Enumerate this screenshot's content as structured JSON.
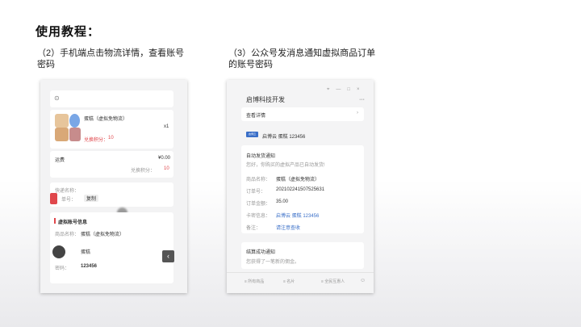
{
  "heading": "使用教程：",
  "left_caption": "（2）手机端点击物流详情，查看账号密码",
  "right_caption": "（3）公众号发消息通知虚拟商品订单的账号密码",
  "phone": {
    "product_name": "蛋糕（虚拟免物流）",
    "qty": "x1",
    "points_label": "兑换积分：",
    "points_value": "10",
    "freight_label": "运费",
    "freight_value": "¥0.00",
    "points2_label": "兑换积分：",
    "points2_value": "10",
    "express_name_label": "快递名称：",
    "tracking_label": "单号：",
    "copy_label": "复制",
    "virtual_title": "虚拟账号信息",
    "goods_name_label": "商品名称：",
    "goods_name_value": "蛋糕（虚拟免物流）",
    "account_value": "蛋糕",
    "password_label": "密码：",
    "password_value": "123456"
  },
  "wechat": {
    "window_controls": [
      "⌖",
      "—",
      "□",
      "×"
    ],
    "account_title": "启博科技开发",
    "more": "···",
    "view_detail": "查看详情",
    "brand_tag": "启博云",
    "brand_msg": "启博云 蛋糕 123456",
    "notice_title": "自动发货通知",
    "notice_sub": "您好，你购买的虚拟产品已自动发货!",
    "rows": [
      {
        "label": "商品名称：",
        "value": "蛋糕（虚拟免物流）"
      },
      {
        "label": "订单号：",
        "value": "2021022415075256​31"
      },
      {
        "label": "订单金额：",
        "value": "35.00"
      },
      {
        "label": "卡密信息：",
        "value": "启博云 蛋糕 123456"
      },
      {
        "label": "备注：",
        "value": "请注意查收"
      }
    ],
    "settle_title": "结算成功通知",
    "settle_sub": "您获得了一笔新的佣金。",
    "bottom_menu": [
      "≡ 所有商品",
      "≡ 名片",
      "≡ 全民互惠人"
    ],
    "colors": {
      "accent": "#3a6fc8",
      "red": "#e0474c"
    }
  }
}
